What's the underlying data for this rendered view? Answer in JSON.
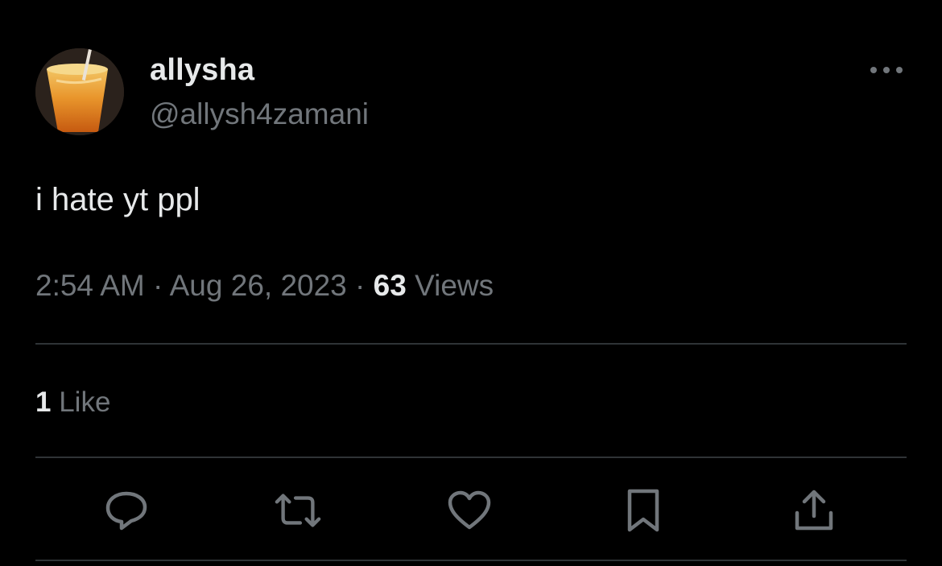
{
  "tweet": {
    "display_name": "allysha",
    "handle": "@allysh4zamani",
    "text": "i hate yt ppl",
    "time": "2:54 AM",
    "separator": "·",
    "date": "Aug 26, 2023",
    "views_count": "63",
    "views_label": "Views",
    "likes_count": "1",
    "likes_label": "Like"
  },
  "icons": {
    "more": "more-horizontal-icon",
    "reply": "reply-icon",
    "retweet": "retweet-icon",
    "like": "heart-icon",
    "bookmark": "bookmark-icon",
    "share": "share-icon"
  },
  "colors": {
    "background": "#000000",
    "primary_text": "#e7e9ea",
    "secondary_text": "#71767b",
    "divider": "#2f3336"
  }
}
